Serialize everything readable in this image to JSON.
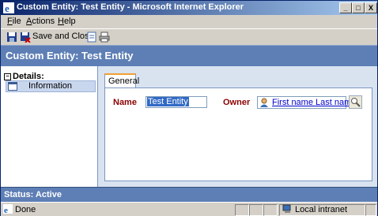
{
  "window": {
    "title": "Custom Entity: Test Entity - Microsoft Internet Explorer",
    "controls": {
      "minimize": "_",
      "maximize": "□",
      "close": "X"
    }
  },
  "menu": {
    "items": [
      {
        "pre": "",
        "key": "F",
        "post": "ile"
      },
      {
        "pre": "",
        "key": "A",
        "post": "ctions"
      },
      {
        "pre": "",
        "key": "H",
        "post": "elp"
      }
    ]
  },
  "toolbar": {
    "save_and_close_label": "Save and Close",
    "icons": [
      "save-icon",
      "save-and-close-icon",
      "attach-icon",
      "print-icon"
    ]
  },
  "header": {
    "title": "Custom Entity: Test Entity"
  },
  "left_nav": {
    "section_title": "Details:",
    "collapse_glyph": "−",
    "items": [
      {
        "label": "Information",
        "icon": "form-icon"
      }
    ]
  },
  "form": {
    "tabs": [
      {
        "label": "General",
        "selected": true
      }
    ],
    "name_label": "Name",
    "name_value": "Test Entity",
    "owner_label": "Owner",
    "owner_value": "First name Last name",
    "owner_icon": "user-icon",
    "lookup_icon": "lookup-icon"
  },
  "form_status": {
    "text": "Status: Active"
  },
  "ie_status": {
    "text": "Done",
    "zone": "Local intranet"
  },
  "colors": {
    "header_bg": "#5e7fb5",
    "field_label": "#8b0000",
    "link": "#0000cc",
    "selection": "#316ac5"
  }
}
